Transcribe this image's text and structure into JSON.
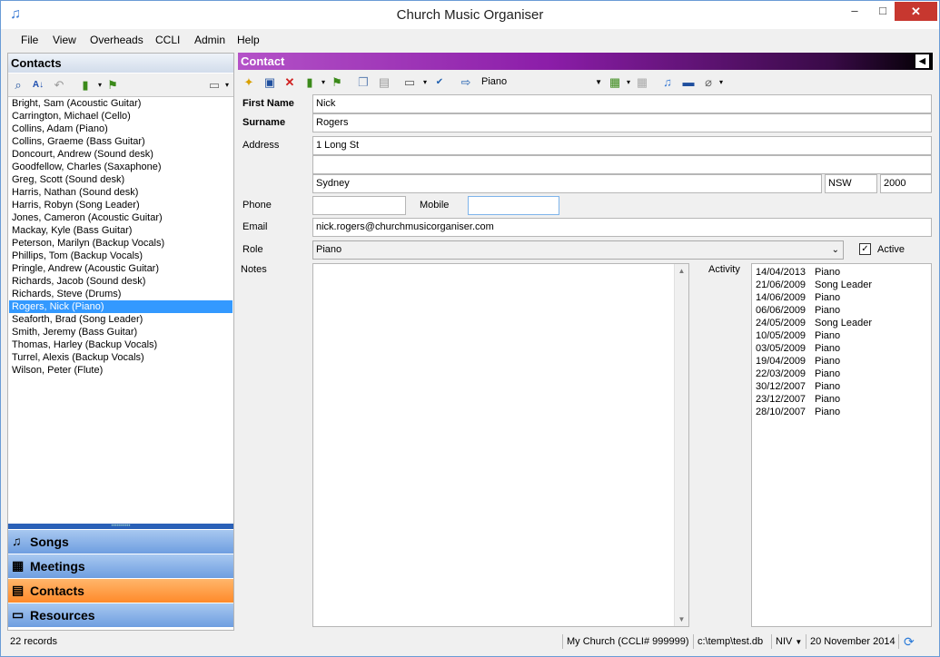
{
  "window": {
    "title": "Church Music Organiser",
    "minimize": "–",
    "maximize": "□",
    "close": "✕"
  },
  "menu": [
    "File",
    "View",
    "Overheads",
    "CCLI",
    "Admin",
    "Help"
  ],
  "left": {
    "header": "Contacts",
    "contacts": [
      "Bright, Sam (Acoustic Guitar)",
      "Carrington, Michael (Cello)",
      "Collins, Adam (Piano)",
      "Collins, Graeme (Bass Guitar)",
      "Doncourt, Andrew (Sound desk)",
      "Goodfellow, Charles (Saxaphone)",
      "Greg, Scott (Sound desk)",
      "Harris, Nathan (Sound desk)",
      "Harris, Robyn (Song Leader)",
      "Jones, Cameron (Acoustic Guitar)",
      "Mackay, Kyle (Bass Guitar)",
      "Peterson, Marilyn (Backup Vocals)",
      "Phillips, Tom (Backup Vocals)",
      "Pringle, Andrew (Acoustic Guitar)",
      "Richards, Jacob (Sound desk)",
      "Richards, Steve (Drums)",
      "Rogers, Nick (Piano)",
      "Seaforth, Brad (Song Leader)",
      "Smith, Jeremy (Bass Guitar)",
      "Thomas, Harley (Backup Vocals)",
      "Turrel, Alexis (Backup Vocals)",
      "Wilson, Peter (Flute)"
    ],
    "selected_index": 16,
    "nav": [
      {
        "label": "Songs",
        "icon": "music-note-icon",
        "glyph": "♫",
        "active": false
      },
      {
        "label": "Meetings",
        "icon": "calendar-icon",
        "glyph": "▦",
        "active": false
      },
      {
        "label": "Contacts",
        "icon": "contact-card-icon",
        "glyph": "▤",
        "active": true
      },
      {
        "label": "Resources",
        "icon": "monitor-icon",
        "glyph": "▭",
        "active": false
      }
    ]
  },
  "contact": {
    "header": "Contact",
    "toolbar_role": "Piano",
    "labels": {
      "first_name": "First Name",
      "surname": "Surname",
      "address": "Address",
      "phone": "Phone",
      "mobile": "Mobile",
      "email": "Email",
      "role": "Role",
      "active": "Active",
      "notes": "Notes",
      "activity": "Activity"
    },
    "first_name": "Nick",
    "surname": "Rogers",
    "address1": "1 Long St",
    "address2": "",
    "city": "Sydney",
    "state": "NSW",
    "postcode": "2000",
    "phone": "",
    "mobile": "",
    "email": "nick.rogers@churchmusicorganiser.com",
    "role": "Piano",
    "active": true,
    "notes": "",
    "activity": [
      {
        "date": "14/04/2013",
        "role": "Piano"
      },
      {
        "date": "21/06/2009",
        "role": "Song Leader"
      },
      {
        "date": "14/06/2009",
        "role": "Piano"
      },
      {
        "date": "06/06/2009",
        "role": "Piano"
      },
      {
        "date": "24/05/2009",
        "role": "Song Leader"
      },
      {
        "date": "10/05/2009",
        "role": "Piano"
      },
      {
        "date": "03/05/2009",
        "role": "Piano"
      },
      {
        "date": "19/04/2009",
        "role": "Piano"
      },
      {
        "date": "22/03/2009",
        "role": "Piano"
      },
      {
        "date": "30/12/2007",
        "role": "Piano"
      },
      {
        "date": "23/12/2007",
        "role": "Piano"
      },
      {
        "date": "28/10/2007",
        "role": "Piano"
      }
    ]
  },
  "status": {
    "records": "22 records",
    "church": "My Church (CCLI# 999999)",
    "db_path": "c:\\temp\\test.db",
    "bible": "NIV",
    "date": "20 November 2014"
  }
}
